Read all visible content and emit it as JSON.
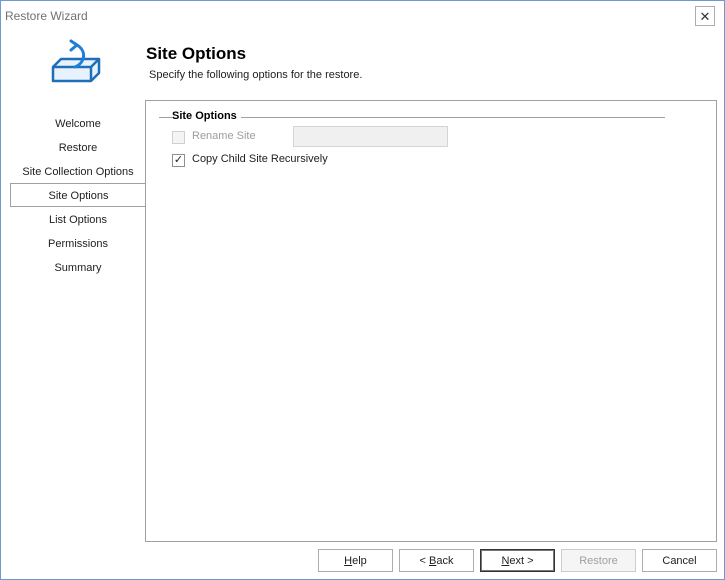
{
  "window": {
    "title": "Restore Wizard",
    "close_glyph": "✕"
  },
  "header": {
    "heading": "Site Options",
    "subheading": "Specify the following options for the restore."
  },
  "nav": {
    "items": [
      {
        "label": "Welcome"
      },
      {
        "label": "Restore"
      },
      {
        "label": "Site Collection Options"
      },
      {
        "label": "Site Options"
      },
      {
        "label": "List Options"
      },
      {
        "label": "Permissions"
      },
      {
        "label": "Summary"
      }
    ],
    "active_index": 3
  },
  "group": {
    "title": "Site Options",
    "rename_site": {
      "label": "Rename Site",
      "checked": false,
      "enabled": false,
      "value": ""
    },
    "copy_child": {
      "label": "Copy Child Site Recursively",
      "checked": true,
      "check_glyph": "✓"
    }
  },
  "buttons": {
    "help": {
      "mnemonic": "H",
      "rest": "elp"
    },
    "back": {
      "prefix": "< ",
      "mnemonic": "B",
      "rest": "ack"
    },
    "next": {
      "mnemonic": "N",
      "rest": "ext >"
    },
    "restore": {
      "label": "Restore"
    },
    "cancel": {
      "label": "Cancel"
    }
  },
  "colors": {
    "accent": "#1f7fd6",
    "border": "#a0a0a0",
    "window_border": "#6d9bd1"
  }
}
